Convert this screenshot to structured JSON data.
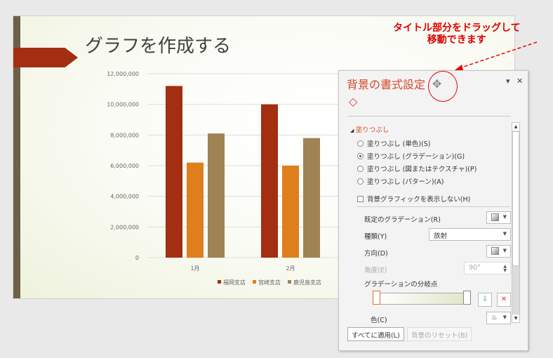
{
  "slide": {
    "title": "グラフを作成する"
  },
  "annotation": {
    "line1": "タイトル部分をドラッグして",
    "line2": "移動できます"
  },
  "chart_data": {
    "type": "bar",
    "categories": [
      "1月",
      "2月"
    ],
    "series": [
      {
        "name": "福岡支店",
        "color": "#a32e12",
        "values": [
          11200000,
          10000000
        ]
      },
      {
        "name": "宮崎支店",
        "color": "#de7e1c",
        "values": [
          6200000,
          6000000
        ]
      },
      {
        "name": "鹿児島支店",
        "color": "#9f8352",
        "values": [
          8100000,
          7800000
        ]
      }
    ],
    "ylim": [
      0,
      12000000
    ],
    "yticks": [
      "0",
      "2,000,000",
      "4,000,000",
      "6,000,000",
      "8,000,000",
      "10,000,000",
      "12,000,000"
    ],
    "legend": "bottom"
  },
  "panel": {
    "title": "背景の書式設定",
    "section": "塗りつぶし",
    "options": [
      {
        "label": "塗りつぶし (単色)(S)",
        "selected": false
      },
      {
        "label": "塗りつぶし (グラデーション)(G)",
        "selected": true
      },
      {
        "label": "塗りつぶし (図またはテクスチャ)(P)",
        "selected": false
      },
      {
        "label": "塗りつぶし (パターン)(A)",
        "selected": false
      }
    ],
    "hide_graphics": "背景グラフィックを表示しない(H)",
    "preset_label": "既定のグラデーション(R)",
    "type_label": "種類(Y)",
    "type_value": "放射",
    "direction_label": "方向(D)",
    "angle_label": "角度(E)",
    "angle_value": "90°",
    "stops_label": "グラデーションの分岐点",
    "color_label": "色(C)",
    "apply_all": "すべてに適用(L)",
    "reset": "背景のリセット(B)"
  }
}
